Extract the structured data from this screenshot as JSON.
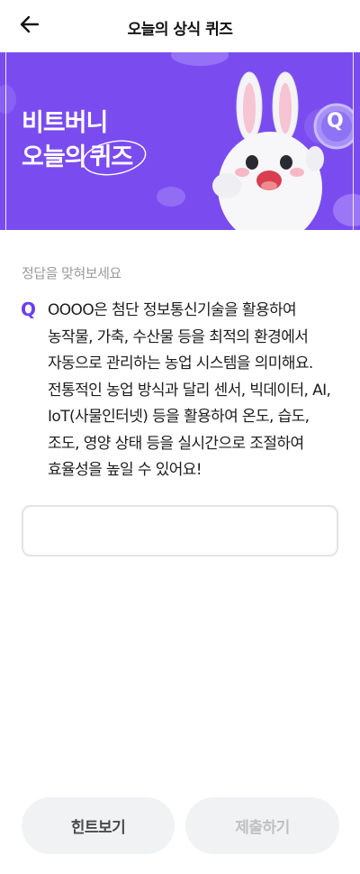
{
  "header": {
    "title": "오늘의 상식 퀴즈",
    "back_icon": "arrow-left-icon"
  },
  "banner": {
    "line1": "비트버니",
    "line2_prefix": "오늘의",
    "line2_highlight": "퀴즈",
    "mascot": "bunny-mascot-holding-q-coin",
    "coin_letter": "Q",
    "background_color": "#7a4cf0"
  },
  "quiz": {
    "instruction": "정답을 맞혀보세요",
    "q_mark": "Q",
    "question": "OOOO은 첨단 정보통신기술을 활용하여 농작물, 가축, 수산물 등을 최적의 환경에서 자동으로 관리하는 농업 시스템을 의미해요. 전통적인 농업 방식과 달리 센서, 빅데이터, AI, IoT(사물인터넷) 등을 활용하여 온도, 습도, 조도, 영양 상태 등을 실시간으로 조절하여 효율성을 높일 수 있어요!",
    "answer_value": "",
    "answer_placeholder": ""
  },
  "actions": {
    "hint_label": "힌트보기",
    "submit_label": "제출하기"
  },
  "colors": {
    "accent": "#6a3ff0",
    "button_bg": "#f1f2f4",
    "disabled_text": "#c0c0c0"
  }
}
